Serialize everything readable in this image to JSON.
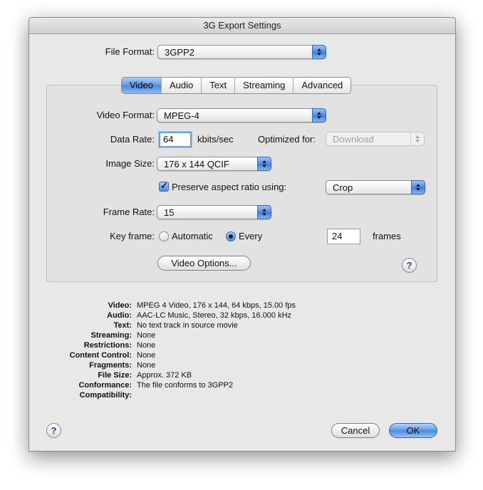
{
  "window": {
    "title": "3G Export Settings"
  },
  "file_format": {
    "label": "File Format:",
    "value": "3GPP2"
  },
  "tabs": [
    {
      "label": "Video",
      "active": true
    },
    {
      "label": "Audio",
      "active": false
    },
    {
      "label": "Text",
      "active": false
    },
    {
      "label": "Streaming",
      "active": false
    },
    {
      "label": "Advanced",
      "active": false
    }
  ],
  "video": {
    "format_label": "Video Format:",
    "format_value": "MPEG-4",
    "data_rate_label": "Data Rate:",
    "data_rate_value": "64",
    "data_rate_unit": "kbits/sec",
    "optimized_label": "Optimized for:",
    "optimized_value": "Download",
    "image_size_label": "Image Size:",
    "image_size_value": "176 x 144 QCIF",
    "preserve_label": "Preserve aspect ratio using:",
    "preserve_checked": true,
    "preserve_value": "Crop",
    "frame_rate_label": "Frame Rate:",
    "frame_rate_value": "15",
    "key_frame_label": "Key frame:",
    "key_frame_automatic": "Automatic",
    "key_frame_every": "Every",
    "key_frame_selected": "Every",
    "key_frame_value": "24",
    "key_frame_unit": "frames",
    "options_button": "Video Options..."
  },
  "summary": [
    {
      "key": "Video:",
      "value": "MPEG 4 Video, 176 x 144, 64 kbps, 15.00 fps"
    },
    {
      "key": "Audio:",
      "value": "AAC-LC Music, Stereo, 32 kbps, 16.000 kHz"
    },
    {
      "key": "Text:",
      "value": "No text track in source movie"
    },
    {
      "key": "Streaming:",
      "value": "None"
    },
    {
      "key": "Restrictions:",
      "value": "None"
    },
    {
      "key": "Content Control:",
      "value": "None"
    },
    {
      "key": "Fragments:",
      "value": "None"
    },
    {
      "key": "File Size:",
      "value": "Approx. 372 KB"
    },
    {
      "key": "Conformance:",
      "value": "The file conforms to 3GPP2"
    },
    {
      "key": "Compatibility:",
      "value": ""
    }
  ],
  "buttons": {
    "help": "?",
    "cancel": "Cancel",
    "ok": "OK"
  },
  "colors": {
    "accent": "#4f8be0",
    "help_glyph": "#5a2a8a"
  }
}
